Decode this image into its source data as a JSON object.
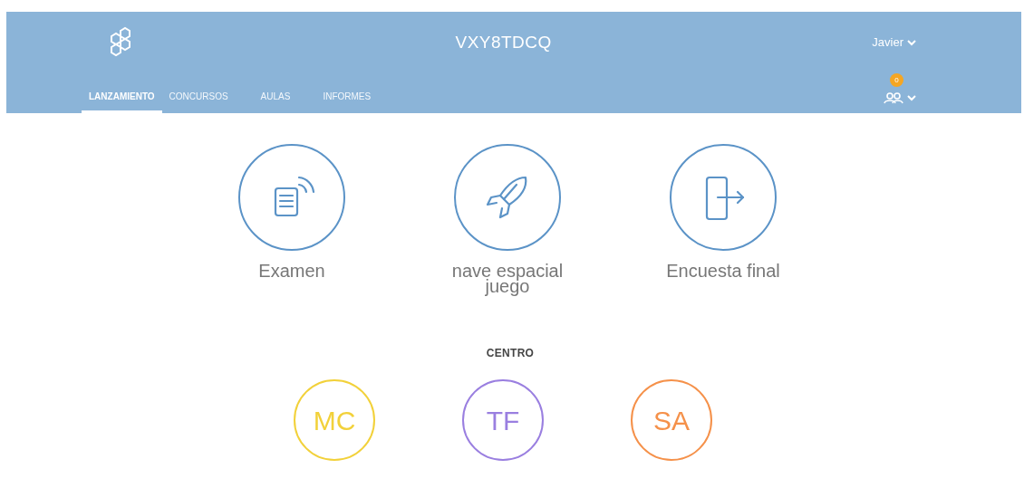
{
  "header": {
    "title": "VXY8TDCQ",
    "user": "Javier",
    "badge": "0"
  },
  "tabs": [
    {
      "label": "LANZAMIENTO",
      "selected": true
    },
    {
      "label": "CONCURSOS",
      "selected": false
    },
    {
      "label": "AULAS",
      "selected": false
    },
    {
      "label": "INFORMES",
      "selected": false
    }
  ],
  "launch_items": [
    {
      "kind": "quiz",
      "label": "Examen"
    },
    {
      "kind": "rocket",
      "label": "nave espacial juego"
    },
    {
      "kind": "exit",
      "label": "Encuesta final"
    }
  ],
  "section_title": "CENTRO",
  "rooms": [
    {
      "initials": "MC",
      "color": "#f2d13a"
    },
    {
      "initials": "TF",
      "color": "#9a7fe0"
    },
    {
      "initials": "SA",
      "color": "#f5914a"
    }
  ]
}
